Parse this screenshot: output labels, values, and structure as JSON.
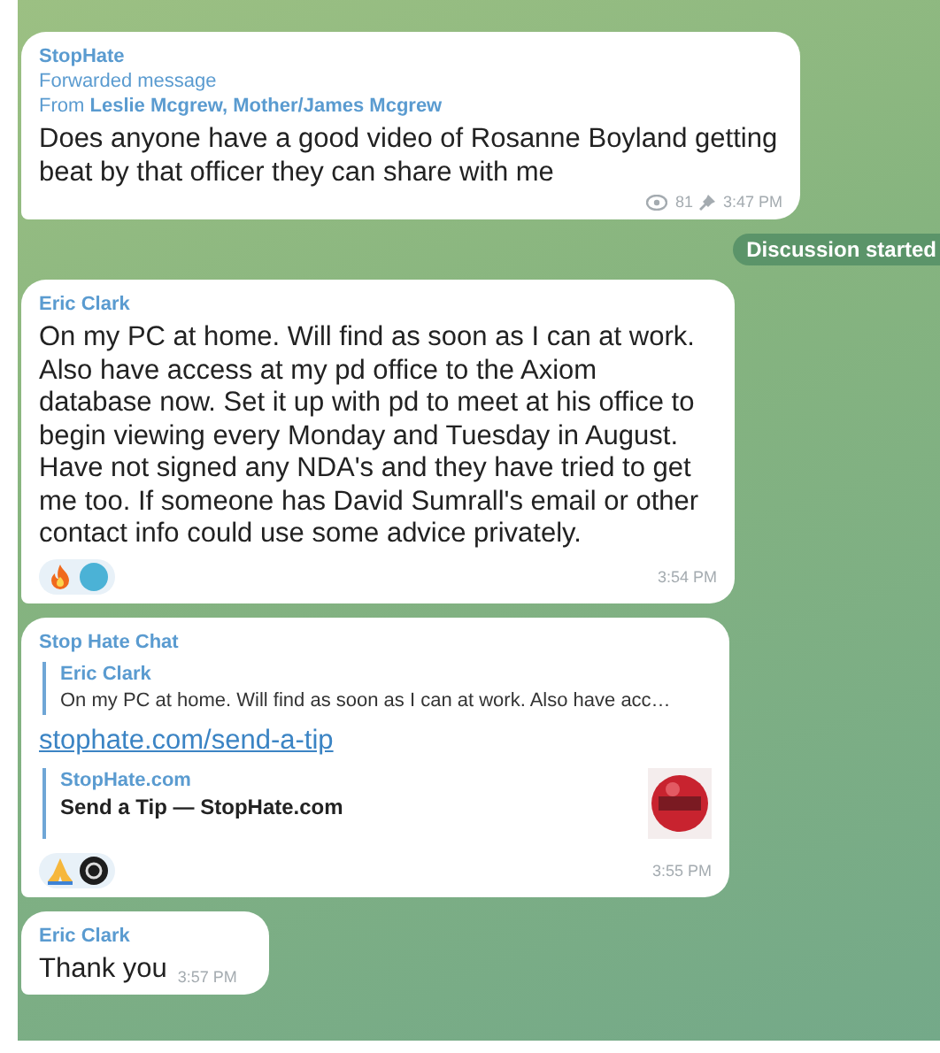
{
  "messages": [
    {
      "kind": "forwarded",
      "sender": "StopHate",
      "forward_label": "Forwarded message",
      "from_prefix": "From",
      "from_name": "Leslie Mcgrew, Mother/James Mcgrew",
      "text": "Does anyone have a good video of Rosanne Boyland getting beat by that officer they can share with me",
      "views": "81",
      "time": "3:47 PM"
    },
    {
      "kind": "service",
      "text": "Discussion started"
    },
    {
      "kind": "text",
      "sender": "Eric Clark",
      "text": "On my PC at home. Will find as soon as I can at work. Also have access at my pd office to the Axiom database now. Set it up with pd to meet at his office to begin viewing every Monday and Tuesday in August. Have not signed any NDA's and they have tried to get me too. If someone has David Sumrall's email or other contact info could use some advice privately.",
      "reactions": [
        {
          "kind": "fire"
        },
        {
          "kind": "avatar"
        }
      ],
      "time": "3:54 PM"
    },
    {
      "kind": "link",
      "sender": "Stop Hate Chat",
      "reply": {
        "sender": "Eric Clark",
        "text": "On my PC at home. Will find as soon as I can at work. Also have acc…"
      },
      "link": "stophate.com/send-a-tip",
      "preview": {
        "site": "StopHate.com",
        "title": "Send a Tip — StopHate.com"
      },
      "reactions": [
        {
          "kind": "pray"
        },
        {
          "kind": "badge"
        }
      ],
      "time": "3:55 PM"
    },
    {
      "kind": "short",
      "sender": "Eric Clark",
      "text": "Thank you",
      "time": "3:57 PM"
    }
  ]
}
